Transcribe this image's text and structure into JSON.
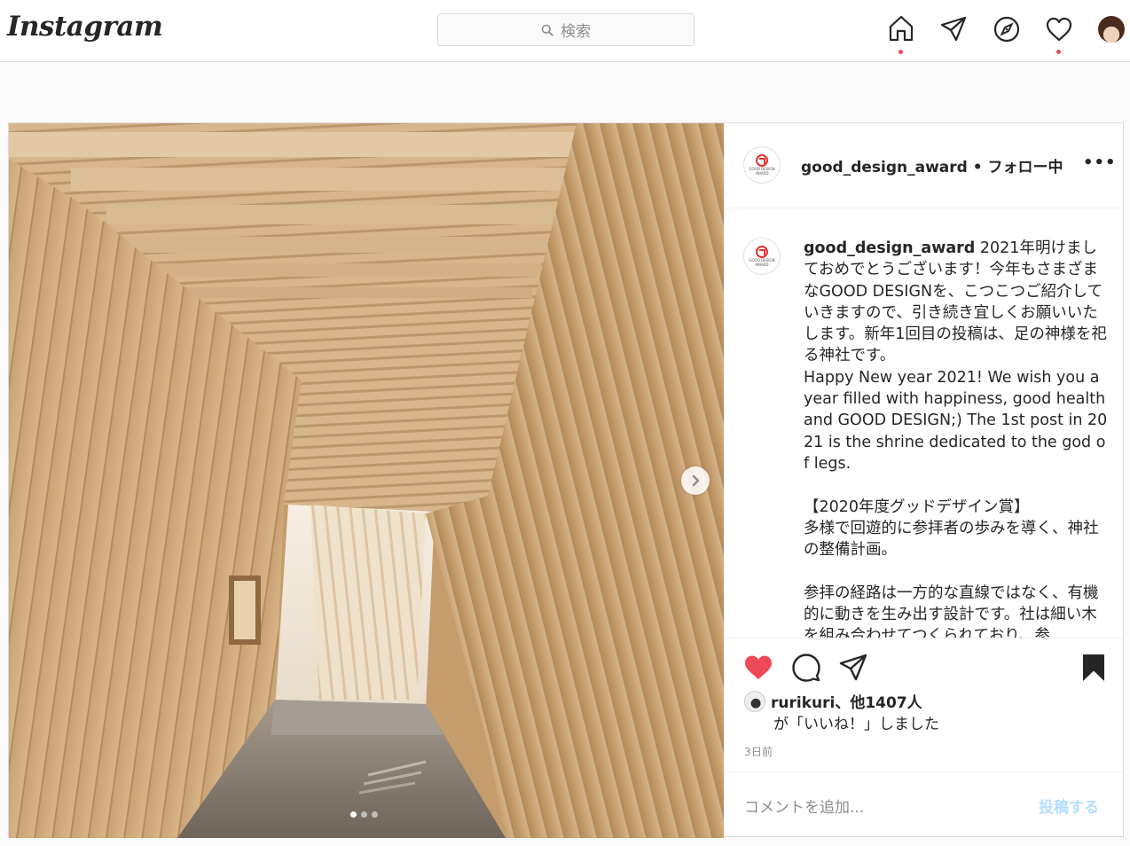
{
  "topbar": {
    "logo": "Instagram",
    "search_placeholder": "検索",
    "icons": [
      "home-icon",
      "direct-icon",
      "explore-icon",
      "activity-icon",
      "profile-avatar"
    ]
  },
  "post": {
    "header": {
      "username": "good_design_award",
      "follow_status": "• フォロー中",
      "more": "•••"
    },
    "avatar_text": [
      "GOOD DESIGN",
      "AWARD"
    ],
    "caption": {
      "username": "good_design_award",
      "text": " 2021年明けましておめでとうございます！今年もさまざまなGOOD DESIGNを、こつこつご紹介していきますので、引き続き宜しくお願いいたします。新年1回目の投稿は、足の神様を祀る神社です。\nHappy New year 2021! We wish you a year filled with happiness, good health and GOOD DESIGN;) The 1st post in 2021 is the shrine dedicated to the god of legs.\n\n【2020年度グッドデザイン賞】\n多様で回遊的に参拝者の歩みを導く、神社の整備計画。\n\n参拝の経路は一方的な直線ではなく、有機的に動きを生み出す設計です。社は細い木を組み合わせてつくられており、参"
    },
    "likes": {
      "user": "rurikuri",
      "others": "、他1407人",
      "suffix": "が「いいね！」しました"
    },
    "time": "3日前",
    "comment": {
      "placeholder": "コメントを追加...",
      "submit": "投稿する"
    },
    "carousel": {
      "current": 1,
      "total": 3
    },
    "colors": {
      "like": "#ed4956",
      "post_disabled": "#b2dffc",
      "notification_dot": "#ed4956"
    }
  }
}
